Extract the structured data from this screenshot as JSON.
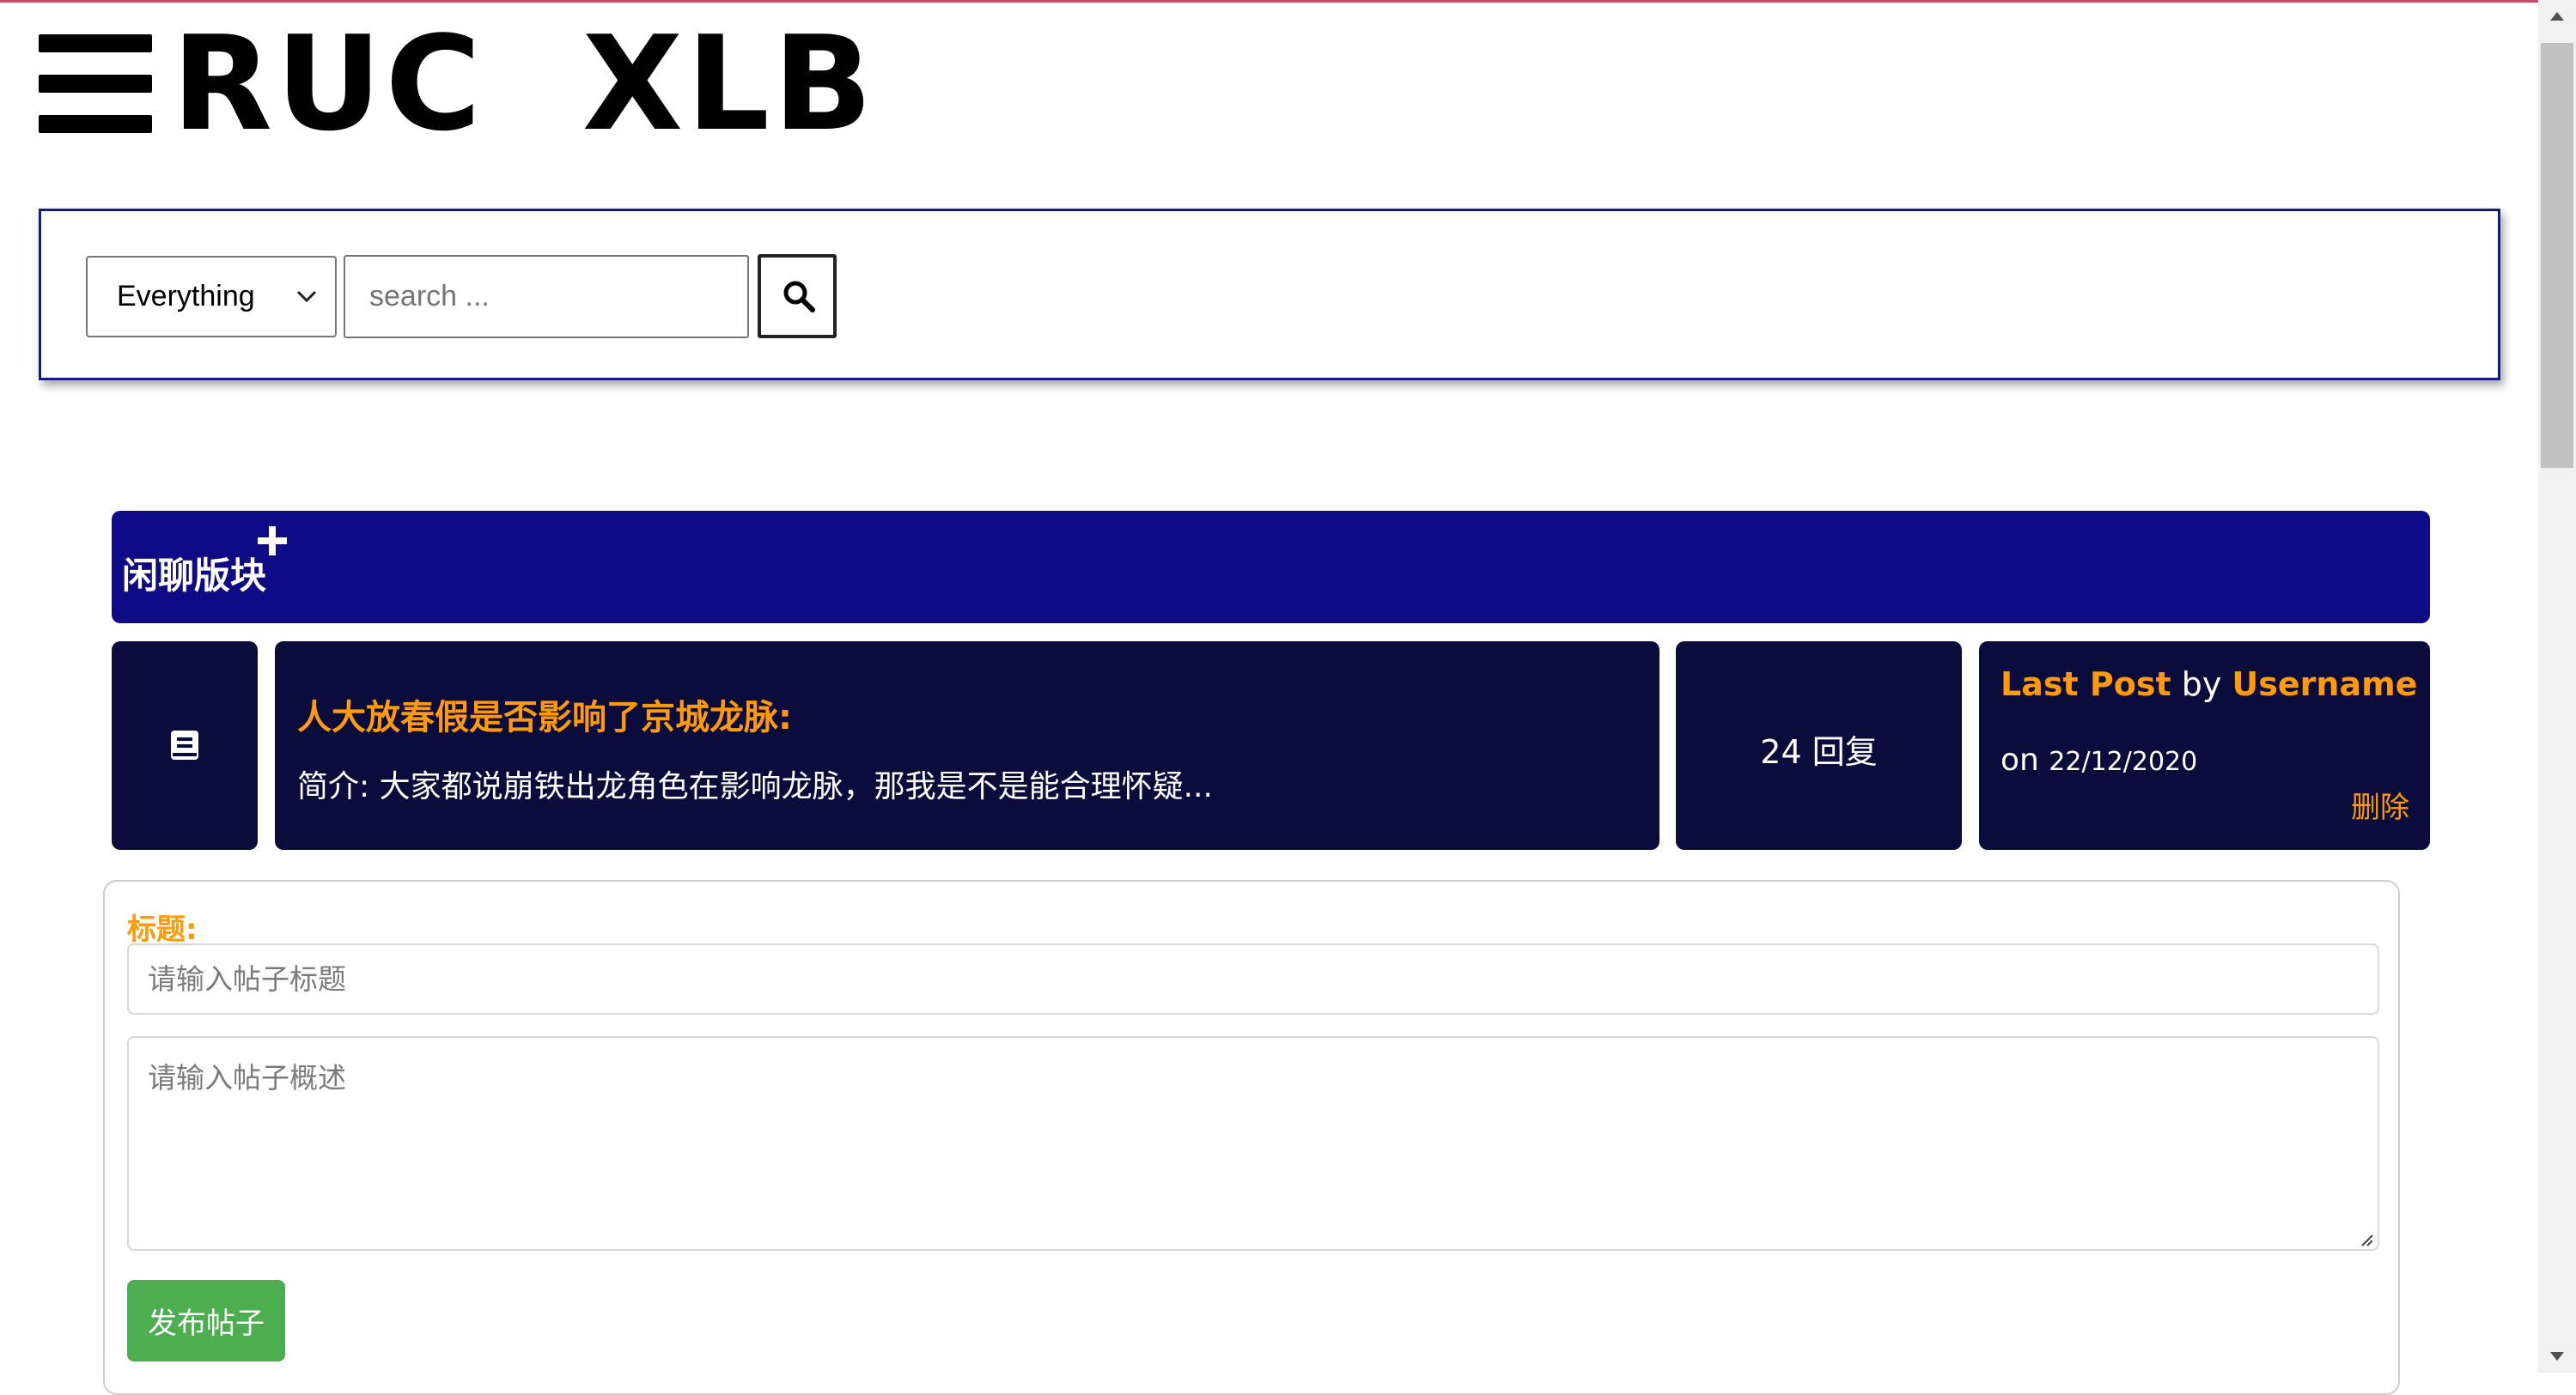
{
  "header": {
    "menu_icon": "hamburger-menu-icon",
    "logo_text": "RUC  XLB"
  },
  "search": {
    "scope_value": "Everything",
    "placeholder": "search ...",
    "button_icon": "search-icon"
  },
  "forum": {
    "section_title": "闲聊版块",
    "add_icon": "plus-icon",
    "topics": [
      {
        "icon": "book-icon",
        "title": "人大放春假是否影响了京城龙脉:",
        "summary": "简介: 大家都说崩铁出龙角色在影响龙脉，那我是不是能合理怀疑...",
        "replies": "24 回复",
        "last_post_label": "Last Post",
        "by": "by",
        "username": "Username",
        "on": "on",
        "date": "22/12/2020",
        "delete_label": "删除"
      }
    ]
  },
  "new_post": {
    "title_label": "标题:",
    "title_placeholder": "请输入帖子标题",
    "summary_placeholder": "请输入帖子概述",
    "submit_label": "发布帖子"
  },
  "colors": {
    "accent_orange": "#ff9a0a",
    "section_header_bg": "#0f0a86",
    "card_bg": "#0a0c3c",
    "submit_green": "#4cae4f"
  }
}
